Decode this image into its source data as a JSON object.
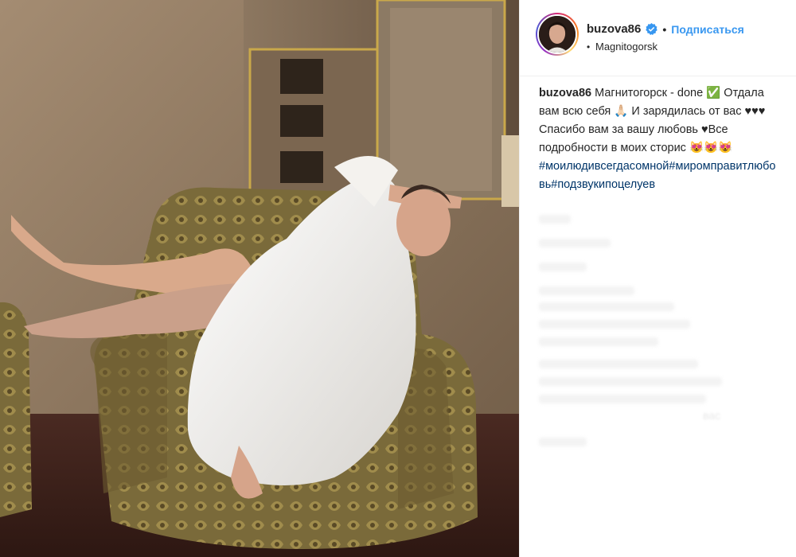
{
  "post": {
    "username": "buzova86",
    "follow_label": "Подписаться",
    "separator": "•",
    "location": "Magnitogorsk",
    "caption": {
      "author": "buzova86",
      "text": "Магнитогорск - done ✅ Отдала вам всю себя 🙏🏻 И зарядилась от вас ♥♥♥ Спасибо вам за вашу любовь ♥Все подробности в моих сторис 😻😻😻",
      "hashtags": "#моилюдивсегдасомной#миромправитлюбовь#подзвукипоцелуев"
    },
    "faint_comment_fragment": "вас"
  },
  "colors": {
    "link_blue": "#3897f0",
    "hashtag": "#003569",
    "text": "#262626"
  },
  "icons": {
    "verified": "verified-badge-icon"
  }
}
